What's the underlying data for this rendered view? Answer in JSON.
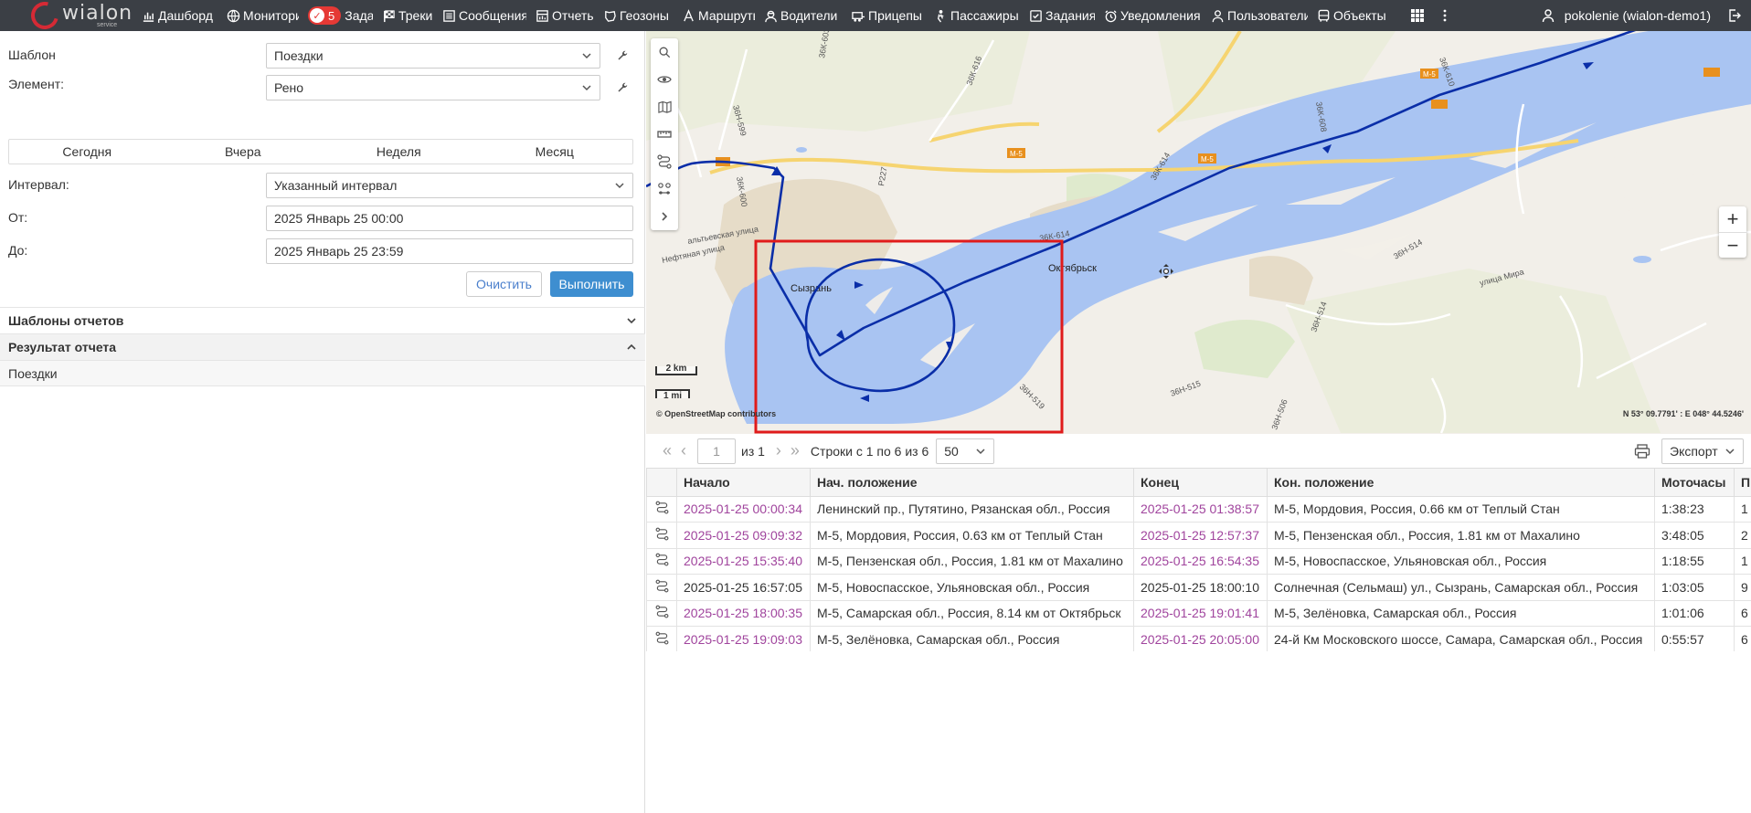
{
  "app": {
    "logo_text": "wialon",
    "logo_sub": "service",
    "brand_color": "#d52a35",
    "topbar_color": "#3b3f45"
  },
  "nav": [
    {
      "label": "Дашборд",
      "icon": "bar-chart-icon"
    },
    {
      "label": "Мониторинг",
      "icon": "globe-icon"
    },
    {
      "label": "Задачи",
      "icon": "check-circle-icon",
      "badge": "5"
    },
    {
      "label": "Треки",
      "icon": "checkered-flag-icon"
    },
    {
      "label": "Сообщения",
      "icon": "message-list-icon"
    },
    {
      "label": "Отчеты",
      "icon": "report-icon"
    },
    {
      "label": "Геозоны",
      "icon": "geofence-icon"
    },
    {
      "label": "Маршруты",
      "icon": "route-icon"
    },
    {
      "label": "Водители",
      "icon": "driver-icon"
    },
    {
      "label": "Прицепы",
      "icon": "trailer-icon"
    },
    {
      "label": "Пассажиры",
      "icon": "passenger-icon"
    },
    {
      "label": "Задания",
      "icon": "task-icon"
    },
    {
      "label": "Уведомления",
      "icon": "alarm-clock-icon"
    },
    {
      "label": "Пользователи",
      "icon": "user-icon"
    },
    {
      "label": "Объекты",
      "icon": "bus-icon"
    }
  ],
  "user": {
    "name": "pokolenie (wialon-demo1)"
  },
  "form": {
    "template_label": "Шаблон",
    "template_value": "Поездки",
    "element_label": "Элемент:",
    "element_value": "Рено",
    "periods": [
      "Сегодня",
      "Вчера",
      "Неделя",
      "Месяц"
    ],
    "interval_label": "Интервал:",
    "interval_value": "Указанный интервал",
    "from_label": "От:",
    "from_value": "2025 Январь 25 00:00",
    "to_label": "До:",
    "to_value": "2025 Январь 25 23:59",
    "clear_label": "Очистить",
    "run_label": "Выполнить"
  },
  "sections": {
    "templates": "Шаблоны отчетов",
    "result": "Результат отчета",
    "result_item": "Поездки"
  },
  "map": {
    "attribution": "© OpenStreetMap contributors",
    "coords": "N 53° 09.7791' : E 048° 44.5246'",
    "scale_km": "2 km",
    "scale_mi": "1 mi",
    "labels": {
      "syzran": "Сызрань",
      "oktyabrsk": "Октябрьск",
      "m5_a": "М-5",
      "m5_b": "М-5",
      "m5_c": "М-5",
      "r227": "Р227",
      "k616": "36К-616",
      "k603": "36К-603",
      "k599": "36Н-599",
      "k600": "36К-600",
      "k614a": "36К-614",
      "k614b": "36К-614",
      "k608": "36К-608",
      "k610": "36К-610",
      "k514a": "36Н-514",
      "k514b": "36Н-514",
      "k519": "36Н-519",
      "k515": "36Н-515",
      "k506": "36Н-506",
      "neftyanaya": "Нефтяная улица",
      "altyevskaya": "альтьевская улица",
      "mira": "улица Мира"
    },
    "track_color": "#0a2ea8",
    "highlight_color": "#e01b1b",
    "water_color": "#a9c4f2"
  },
  "pager": {
    "page": "1",
    "of": "из 1",
    "rows_text": "Строки с 1 по 6 из 6",
    "per_page": "50",
    "export_label": "Экспорт"
  },
  "table": {
    "columns": [
      "",
      "Начало",
      "Нач. положение",
      "Конец",
      "Кон. положение",
      "Моточасы",
      "Пр"
    ],
    "rows": [
      {
        "start": "2025-01-25 00:00:34",
        "start_pos": "Ленинский пр., Путятино, Рязанская обл., Россия",
        "end": "2025-01-25 01:38:57",
        "end_pos": "М-5, Мордовия, Россия, 0.66 км от Теплый Стан",
        "hours": "1:38:23",
        "p": "1",
        "link": true
      },
      {
        "start": "2025-01-25 09:09:32",
        "start_pos": "М-5, Мордовия, Россия, 0.63 км от Теплый Стан",
        "end": "2025-01-25 12:57:37",
        "end_pos": "М-5, Пензенская обл., Россия, 1.81 км от Махалино",
        "hours": "3:48:05",
        "p": "2",
        "link": true
      },
      {
        "start": "2025-01-25 15:35:40",
        "start_pos": "М-5, Пензенская обл., Россия, 1.81 км от Махалино",
        "end": "2025-01-25 16:54:35",
        "end_pos": "М-5, Новоспасское, Ульяновская обл., Россия",
        "hours": "1:18:55",
        "p": "1",
        "link": true
      },
      {
        "start": "2025-01-25 16:57:05",
        "start_pos": "М-5, Новоспасское, Ульяновская обл., Россия",
        "end": "2025-01-25 18:00:10",
        "end_pos": "Солнечная (Сельмаш) ул., Сызрань, Самарская обл., Россия",
        "hours": "1:03:05",
        "p": "9",
        "link": false
      },
      {
        "start": "2025-01-25 18:00:35",
        "start_pos": "М-5, Самарская обл., Россия, 8.14 км от Октябрьск",
        "end": "2025-01-25 19:01:41",
        "end_pos": "М-5, Зелёновка, Самарская обл., Россия",
        "hours": "1:01:06",
        "p": "6",
        "link": true
      },
      {
        "start": "2025-01-25 19:09:03",
        "start_pos": "М-5, Зелёновка, Самарская обл., Россия",
        "end": "2025-01-25 20:05:00",
        "end_pos": "24-й Км Московского шоссе, Самара, Самарская обл., Россия",
        "hours": "0:55:57",
        "p": "6",
        "link": true
      }
    ]
  }
}
